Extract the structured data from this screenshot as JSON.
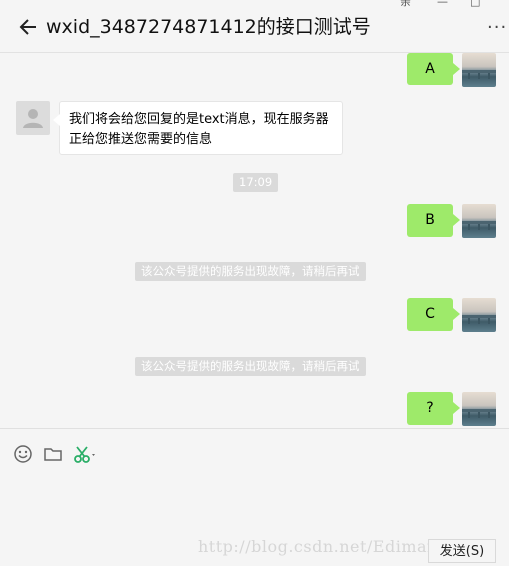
{
  "header": {
    "title": "wxid_3487274871412的接口测试号",
    "window_controls": [
      "亲",
      "—",
      "□",
      "✕"
    ],
    "more_label": "···"
  },
  "messages": [
    {
      "from": "me",
      "text": "A"
    },
    {
      "from": "other",
      "text": "我们将会给您回复的是text消息，现在服务器正给您推送您需要的信息"
    },
    {
      "from": "system",
      "text": "17:09"
    },
    {
      "from": "me",
      "text": "B"
    },
    {
      "from": "system",
      "text": "该公众号提供的服务出现故障，请稍后再试"
    },
    {
      "from": "me",
      "text": "C"
    },
    {
      "from": "system",
      "text": "该公众号提供的服务出现故障，请稍后再试"
    },
    {
      "from": "me",
      "text": "?"
    }
  ],
  "toolbar": {
    "tools": [
      "emoji-icon",
      "folder-icon",
      "scissors-icon"
    ],
    "send_label": "发送(S)"
  },
  "watermark": "http://blog.csdn.net/Edimar_03",
  "colors": {
    "bubble_me": "#9eea6a",
    "bubble_other": "#ffffff",
    "system_tag": "#dadada",
    "background": "#f5f5f5",
    "scissors": "#2aae67"
  }
}
